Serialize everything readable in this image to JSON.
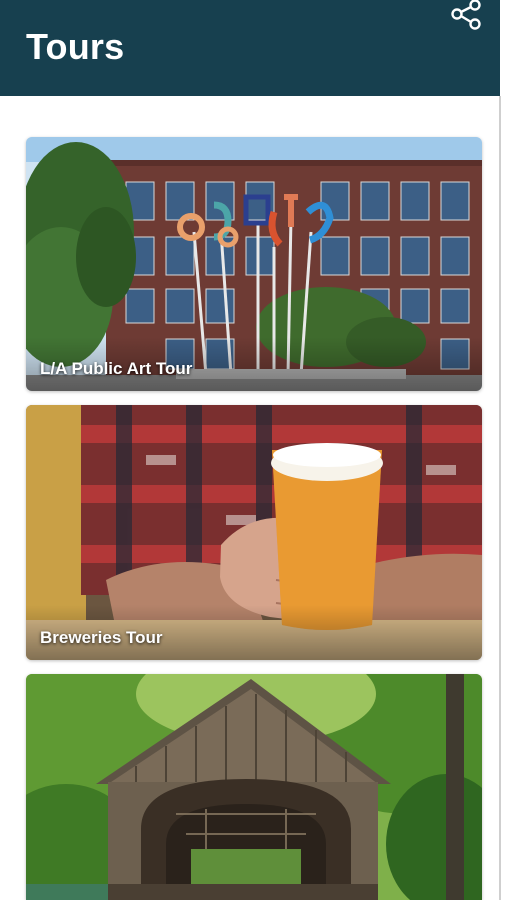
{
  "app_bar": {
    "title": "Tours",
    "share_icon": "share-icon",
    "background_color": "#17404f"
  },
  "tours": [
    {
      "label": "L/A Public Art Tour"
    },
    {
      "label": "Breweries Tour"
    },
    {
      "label": ""
    }
  ]
}
